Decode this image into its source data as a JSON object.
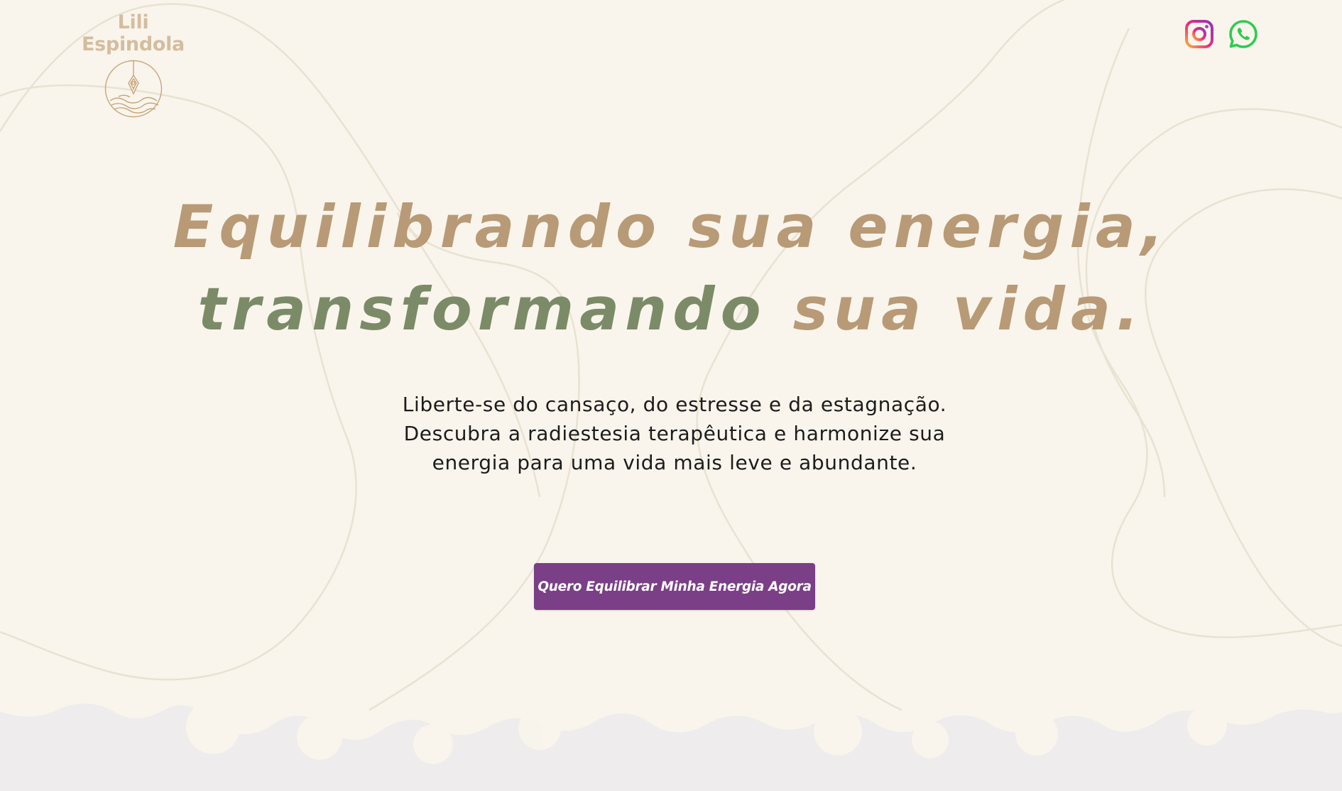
{
  "brand": {
    "name": "Lili Espindola"
  },
  "social": {
    "instagram_icon": "instagram-icon",
    "whatsapp_icon": "whatsapp-icon"
  },
  "hero": {
    "title_line1": "Equilibrando sua energia,",
    "title_line2_word1": "transformando",
    "title_line2_word2": "sua vida.",
    "subtitle_line1": "Liberte-se do cansaço, do estresse e da estagnação.",
    "subtitle_line2": "Descubra a radiestesia terapêutica e harmonize sua",
    "subtitle_line3": "energia para uma vida mais leve e abundante.",
    "cta_label": "Quero Equilibrar Minha Energia Agora"
  },
  "colors": {
    "background": "#f9f5ec",
    "brand_tan": "#b89a76",
    "brand_green": "#7b8b67",
    "cta_purple": "#7a3f86",
    "bottom_band": "#eeecec"
  }
}
